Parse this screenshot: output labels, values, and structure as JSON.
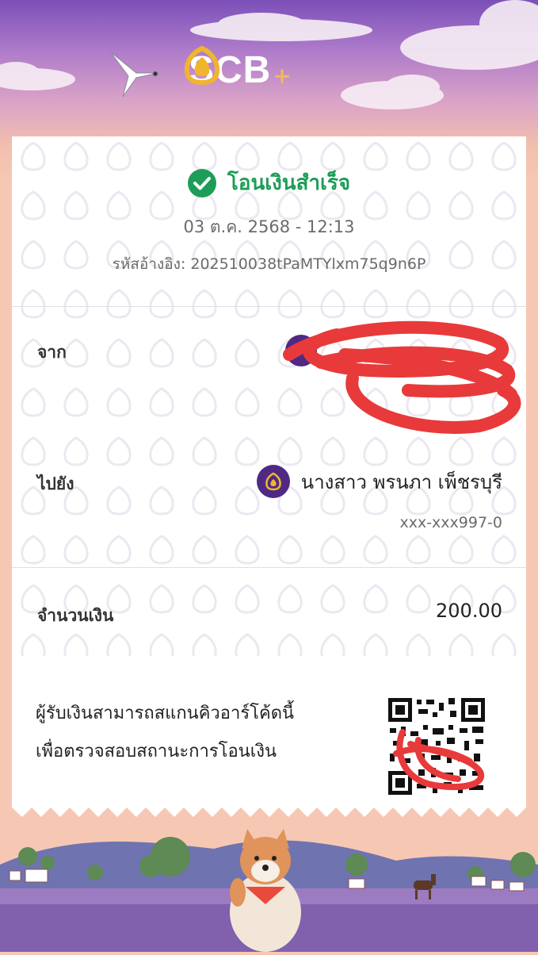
{
  "brand": {
    "name": "SCB",
    "plus": "+"
  },
  "receipt": {
    "status": "โอนเงินสำเร็จ",
    "datetime": "03 ต.ค. 2568 - 12:13",
    "reference_label": "รหัสอ้างอิง:",
    "reference_id": "202510038tPaMTYlxm75q9n6P",
    "from_label": "จาก",
    "to_label": "ไปยัง",
    "to_name": "นางสาว พรนภา เพ็ชรบุรี",
    "to_account": "xxx-xxx997-0",
    "amount_label": "จำนวนเงิน",
    "amount": "200.00",
    "qr_line1": "ผู้รับเงินสามารถสแกนคิวอาร์โค้ดนี้",
    "qr_line2": "เพื่อตรวจสอบสถานะการโอนเงิน"
  },
  "icons": {
    "status": "check-circle-icon",
    "bank_logo": "scb-bank-icon"
  },
  "colors": {
    "success_green": "#1e9d58",
    "scb_purple": "#4e2a84",
    "scribble_red": "#e83a3a"
  }
}
